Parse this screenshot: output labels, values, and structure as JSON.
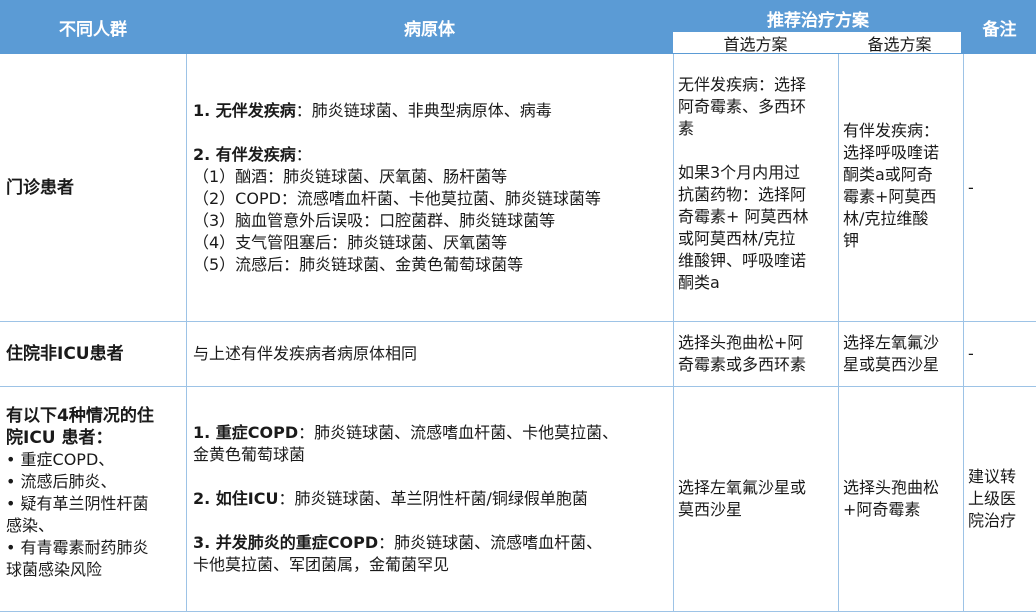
{
  "header": {
    "col1": "不同人群",
    "col2": "病原体",
    "group": "推荐治疗方案",
    "sub1": "首选方案",
    "sub2": "备选方案",
    "col5": "备注"
  },
  "rows": [
    {
      "population": "门诊患者",
      "pathogen": {
        "p1_head": "1. 无伴发疾病",
        "p1_text": "：肺炎链球菌、非典型病原体、病毒",
        "p2_head": "2. 有伴发疾病",
        "p2_colon": "：",
        "items": [
          "（1）酗酒：肺炎链球菌、厌氧菌、肠杆菌等",
          "（2）COPD：流感嗜血杆菌、卡他莫拉菌、肺炎链球菌等",
          "（3）脑血管意外后误吸：口腔菌群、肺炎链球菌等",
          "（4）支气管阻塞后：肺炎链球菌、厌氧菌等",
          "（5）流感后：肺炎链球菌、金黄色葡萄球菌等"
        ]
      },
      "first_choice_a": [
        "无伴发疾病：选择",
        "阿奇霉素、多西环",
        "素"
      ],
      "first_choice_b": [
        "如果3个月内用过",
        "抗菌药物：选择阿",
        "奇霉素+ 阿莫西林",
        "或阿莫西林/克拉",
        "维酸钾、呼吸喹诺",
        "酮类a"
      ],
      "alternative": [
        "有伴发疾病：",
        "选择呼吸喹诺",
        "酮类a或阿奇",
        "霉素+阿莫西",
        "林/克拉维酸",
        "钾"
      ],
      "note": "-"
    },
    {
      "population": "住院非ICU患者",
      "pathogen_text": "与上述有伴发疾病者病原体相同",
      "first_choice": [
        "选择头孢曲松+阿",
        "奇霉素或多西环素"
      ],
      "alternative": [
        "选择左氧氟沙",
        "星或莫西沙星"
      ],
      "note": "-"
    },
    {
      "population_lines": [
        "有以下4种情况的住",
        "院ICU 患者："
      ],
      "bullets": [
        "• 重症COPD、",
        "• 流感后肺炎、",
        "•  疑有革兰阴性杆菌",
        "感染、",
        "•  有青霉素耐药肺炎",
        "球菌感染风险"
      ],
      "pathogen": {
        "a_head": "1.  重症COPD",
        "a_text1": "：肺炎链球菌、流感嗜血杆菌、卡他莫拉菌、",
        "a_text2": "金黄色葡萄球菌",
        "b_head": "2. 如住ICU",
        "b_text": "：肺炎链球菌、革兰阴性杆菌/铜绿假单胞菌",
        "c_head": "3.  并发肺炎的重症COPD",
        "c_text1": "：肺炎链球菌、流感嗜血杆菌、",
        "c_text2": "卡他莫拉菌、军团菌属，金葡菌罕见"
      },
      "first_choice": [
        "选择左氧氟沙星或",
        "莫西沙星"
      ],
      "alternative": [
        "选择头孢曲松",
        "+阿奇霉素"
      ],
      "note": [
        "建议转",
        "上级医",
        "院治疗"
      ]
    }
  ],
  "colors": {
    "header_bg": "#5b9bd5",
    "border": "#9dc3e6"
  }
}
